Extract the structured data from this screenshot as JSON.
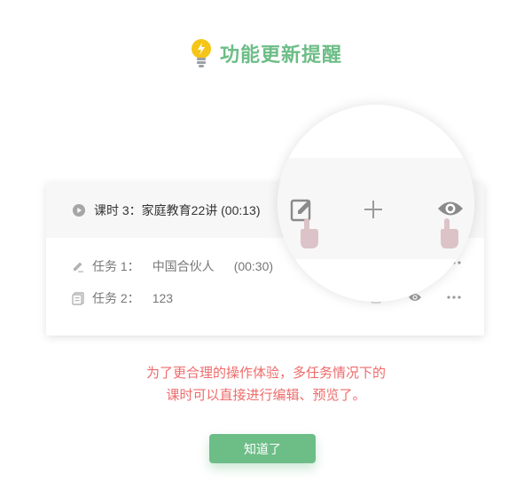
{
  "header": {
    "title": "功能更新提醒",
    "icon": "lightbulb-icon"
  },
  "lesson": {
    "label": "课时 3：家庭教育22讲 (00:13)"
  },
  "tasks": [
    {
      "label": "任务 1：",
      "name": "中国合伙人",
      "duration": "(00:30)",
      "icon": "edit-icon"
    },
    {
      "label": "任务 2：",
      "name": "123",
      "icon": "document-icon"
    }
  ],
  "description": {
    "line1": "为了更合理的操作体验，多任务情况下的",
    "line2": "课时可以直接进行编辑、预览了。"
  },
  "button": {
    "label": "知道了"
  },
  "colors": {
    "accent": "#6dbd87",
    "warning_text": "#ef6b6b",
    "bulb": "#f5c518"
  }
}
